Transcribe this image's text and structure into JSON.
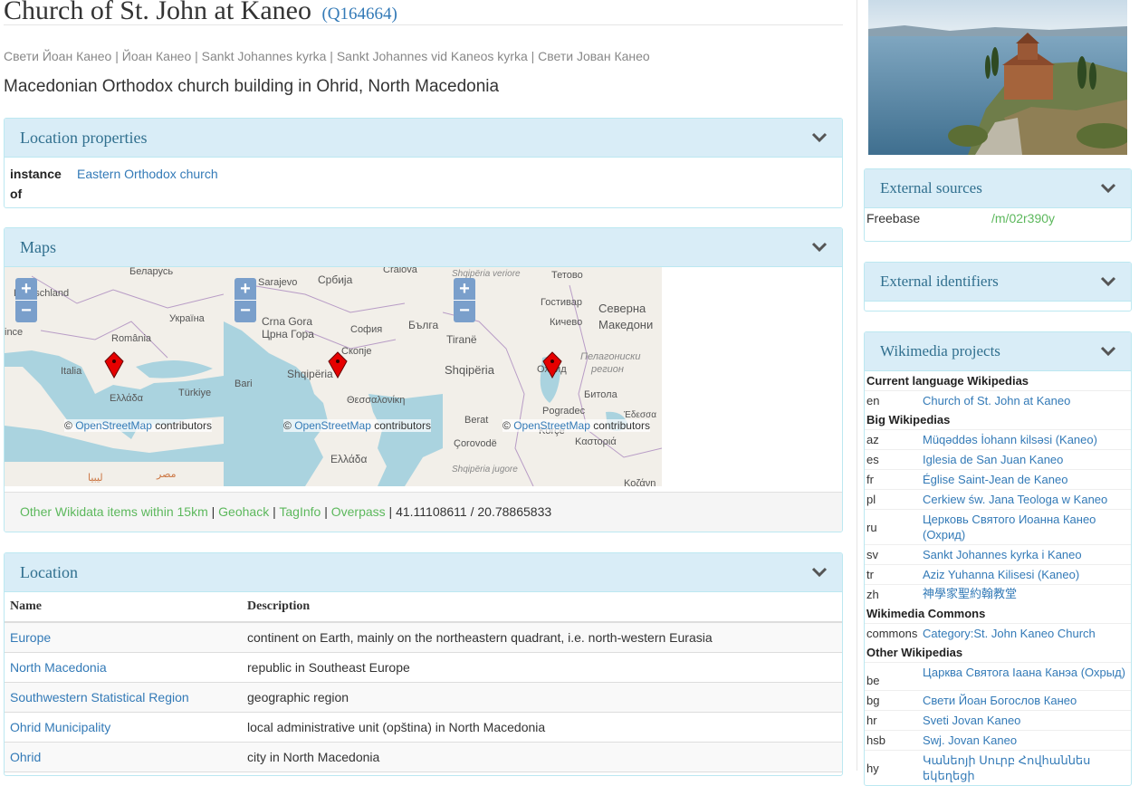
{
  "item": {
    "title": "Church of St. John at Kaneo",
    "qid": "(Q164664)",
    "aliases": "Свети Йоан Канео | Йоан Канео | Sankt Johannes kyrka | Sankt Johannes vid Kaneos kyrka | Свети Јован Канео",
    "description": "Macedonian Orthodox church building in Ohrid, North Macedonia"
  },
  "location_properties": {
    "heading": "Location properties",
    "key_line1": "instance",
    "key_line2": "of",
    "value": "Eastern Orthodox church"
  },
  "maps": {
    "heading": "Maps",
    "zoom_in": "+",
    "zoom_out": "−",
    "attribution_prefix": "©",
    "attribution_link": "OpenStreetMap",
    "attribution_suffix": "contributors",
    "map1_labels": [
      "Беларусь",
      "Deutschland",
      "Україна",
      "România",
      "Italia",
      "Ελλάδα",
      "Türkiye",
      "ince",
      "ليبيا",
      "مصر"
    ],
    "map2_labels": [
      "Sarajevo",
      "Србија",
      "Crna Gora",
      "Црна Гора",
      "София",
      "Бълга",
      "Скопје",
      "Shqipëria",
      "Bari",
      "Θεσσαλονίκη",
      "Ελλάδα",
      "Craiova"
    ],
    "map3_labels": [
      "Shqipëria veriore",
      "Тетово",
      "Гостивар",
      "Северна",
      "Кичево",
      "Македони",
      "Tiranë",
      "Пелагониски",
      "регион",
      "Shqipëria",
      "Охрид",
      "Битола",
      "Pogradec",
      "Berat",
      "Korçë",
      "Έδεσσα",
      "Çorovodë",
      "Καστοριά",
      "Shqipëria jugore",
      "Κοζάνη"
    ],
    "links": [
      "Other Wikidata items within 15km",
      "Geohack",
      "TagInfo",
      "Overpass"
    ],
    "coord_lat": "41.11108611",
    "coord_sep": "/",
    "coord_lon": "20.78865833"
  },
  "location": {
    "heading": "Location",
    "col_name": "Name",
    "col_desc": "Description",
    "rows": [
      {
        "name": "Europe",
        "desc": "continent on Earth, mainly on the northeastern quadrant, i.e. north-western Eurasia"
      },
      {
        "name": "North Macedonia",
        "desc": "republic in Southeast Europe"
      },
      {
        "name": "Southwestern Statistical Region",
        "desc": "geographic region"
      },
      {
        "name": "Ohrid Municipality",
        "desc": "local administrative unit (opština) in North Macedonia"
      },
      {
        "name": "Ohrid",
        "desc": "city in North Macedonia"
      }
    ]
  },
  "external_sources": {
    "heading": "External sources",
    "key": "Freebase",
    "value": "/m/02r390y"
  },
  "external_identifiers": {
    "heading": "External identifiers"
  },
  "wikimedia": {
    "heading": "Wikimedia projects",
    "current_heading": "Current language Wikipedias",
    "current": [
      {
        "code": "en",
        "title": "Church of St. John at Kaneo"
      }
    ],
    "big_heading": "Big Wikipedias",
    "big": [
      {
        "code": "az",
        "title": "Müqəddəs İohann kilsəsi (Kaneo)"
      },
      {
        "code": "es",
        "title": "Iglesia de San Juan Kaneo"
      },
      {
        "code": "fr",
        "title": "Église Saint-Jean de Kaneo"
      },
      {
        "code": "pl",
        "title": "Cerkiew św. Jana Teologa w Kaneo"
      },
      {
        "code": "ru",
        "title": "Церковь Святого Иоанна Канео (Охрид)"
      },
      {
        "code": "sv",
        "title": "Sankt Johannes kyrka i Kaneo"
      },
      {
        "code": "tr",
        "title": "Aziz Yuhanna Kilisesi (Kaneo)"
      },
      {
        "code": "zh",
        "title": "神學家聖約翰教堂"
      }
    ],
    "commons_heading": "Wikimedia Commons",
    "commons": [
      {
        "code": "commons",
        "title": "Category:St. John Kaneo Church"
      }
    ],
    "other_heading": "Other Wikipedias",
    "other": [
      {
        "code": "be",
        "title": "Царква Святога Іаана Канэа (Охрыд)"
      },
      {
        "code": "bg",
        "title": "Свети Йоан Богослов Канео"
      },
      {
        "code": "hr",
        "title": "Sveti Jovan Kaneo"
      },
      {
        "code": "hsb",
        "title": "Swj. Jovan Kaneo"
      },
      {
        "code": "hy",
        "title": "Կանեոյի Սուրբ Հովհաննես եկեղեցի"
      }
    ]
  },
  "colors": {
    "panel_heading_bg": "#d9edf7",
    "panel_border": "#bce8f1",
    "link": "#337ab7",
    "green_link": "#5cb85c",
    "map_sea": "#aad3df",
    "map_land": "#f2efe9",
    "marker": "#e60000"
  }
}
